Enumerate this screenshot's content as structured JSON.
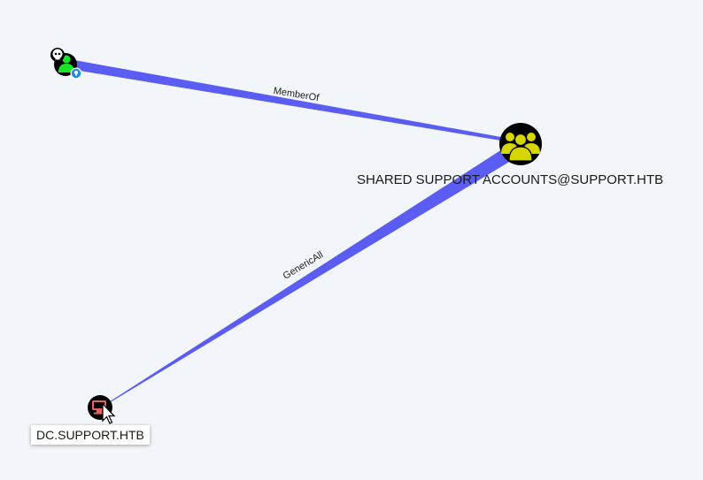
{
  "graph": {
    "nodes": {
      "user": {
        "type": "User",
        "badges": [
          "owned-skull",
          "high-value-marker"
        ]
      },
      "group": {
        "type": "Group",
        "label": "SHARED SUPPORT ACCOUNTS@SUPPORT.HTB"
      },
      "computer": {
        "type": "Computer",
        "label": "DC.SUPPORT.HTB"
      }
    },
    "edges": [
      {
        "source": "user",
        "target": "group",
        "label": "MemberOf"
      },
      {
        "source": "group",
        "target": "computer",
        "label": "GenericAll"
      }
    ]
  },
  "colors": {
    "background": "#f2f5fa",
    "edge": "#5a5cf2",
    "group_icon": "#d6d600",
    "user_icon": "#17e627",
    "computer_icon": "#e7615a"
  }
}
